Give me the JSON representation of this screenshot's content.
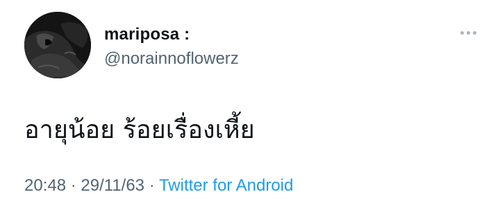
{
  "user": {
    "display_name": "mariposa :",
    "handle": "@norainnoflowerz"
  },
  "tweet": {
    "text": "อายุน้อย ร้อยเรื่องเหี้ย",
    "time": "20:48",
    "separator": " · ",
    "date": "29/11/63",
    "source": "Twitter for Android"
  },
  "icons": {
    "more": "more-horizontal-icon",
    "avatar": "profile-photo"
  },
  "colors": {
    "text": "#0f1419",
    "secondary": "#536471",
    "link": "#1d9bf0",
    "more_dots": "#aab4bc"
  }
}
